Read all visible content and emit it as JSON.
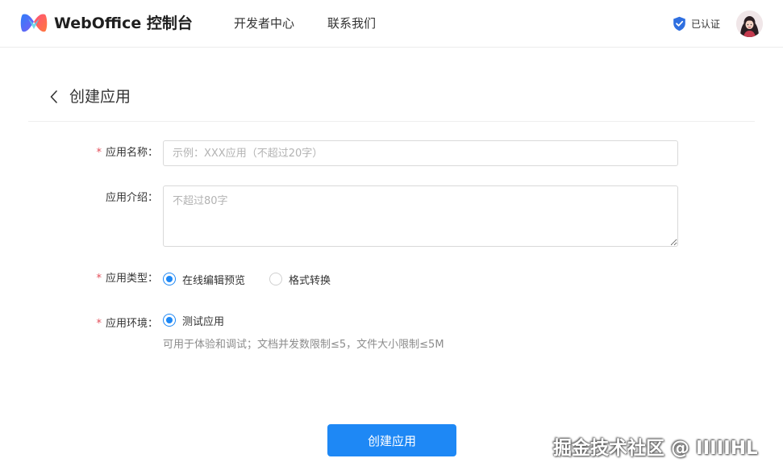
{
  "header": {
    "brand": "WebOffice 控制台",
    "nav": [
      {
        "label": "开发者中心"
      },
      {
        "label": "联系我们"
      }
    ],
    "verified_label": "已认证",
    "icons": {
      "logo": "weboffice-logo-icon",
      "verified": "shield-check-icon",
      "avatar": "user-avatar"
    }
  },
  "page": {
    "title": "创建应用",
    "back_icon": "chevron-left-icon"
  },
  "form": {
    "name": {
      "required": "*",
      "label": "应用名称：",
      "value": "",
      "placeholder": "示例：XXX应用（不超过20字）"
    },
    "intro": {
      "label": "应用介绍：",
      "value": "",
      "placeholder": "不超过80字"
    },
    "type": {
      "required": "*",
      "label": "应用类型：",
      "options": [
        {
          "label": "在线编辑预览",
          "checked": true
        },
        {
          "label": "格式转换",
          "checked": false
        }
      ]
    },
    "env": {
      "required": "*",
      "label": "应用环境：",
      "options": [
        {
          "label": "测试应用",
          "checked": true
        }
      ],
      "hint": "可用于体验和调试；文档并发数限制≤5，文件大小限制≤5M"
    },
    "submit_label": "创建应用"
  },
  "watermark": "掘金技术社区 @ IIIIIHL",
  "colors": {
    "primary": "#1e88f5",
    "required": "#e34d59",
    "border": "#d9d9d9",
    "hint": "#8c8c8c"
  }
}
